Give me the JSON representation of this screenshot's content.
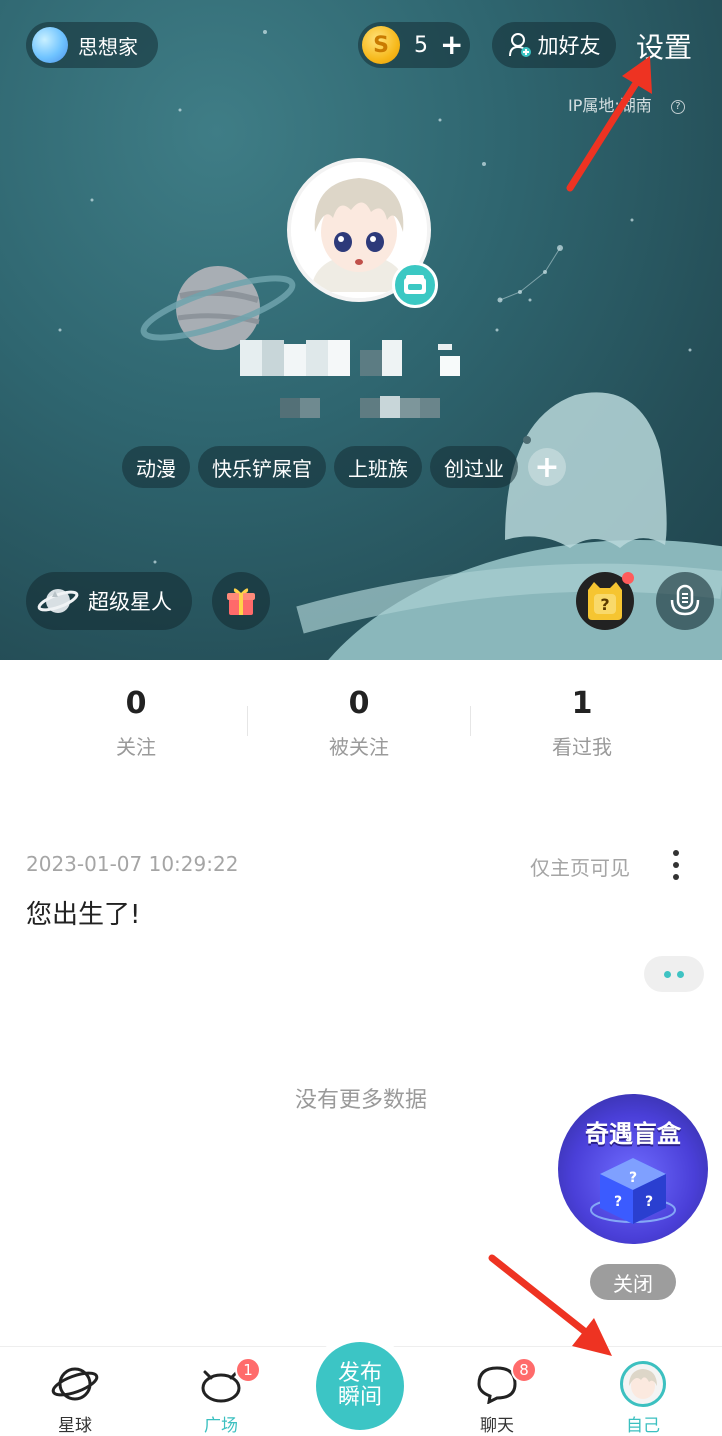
{
  "header": {
    "thinker_label": "思想家",
    "coin_symbol": "S",
    "coin_count": "5",
    "coin_plus": "+",
    "add_friend_label": "加好友",
    "settings_label": "设置",
    "ip_location": "IP属地:湖南",
    "help_symbol": "?"
  },
  "profile": {
    "tags": [
      "动漫",
      "快乐铲屎官",
      "上班族",
      "创过业"
    ],
    "add_tag_symbol": "+",
    "super_star_label": "超级星人"
  },
  "stats": [
    {
      "value": "0",
      "label": "关注"
    },
    {
      "value": "0",
      "label": "被关注"
    },
    {
      "value": "1",
      "label": "看过我"
    }
  ],
  "post": {
    "timestamp": "2023-01-07 10:29:22",
    "visibility": "仅主页可见",
    "content": "您出生了!"
  },
  "feed": {
    "no_more": "没有更多数据"
  },
  "blind_box": {
    "title": "奇遇盲盒",
    "close_label": "关闭"
  },
  "nav": {
    "items": [
      {
        "label": "星球",
        "icon": "planet-icon"
      },
      {
        "label": "广场",
        "icon": "square-icon",
        "badge": "1"
      },
      {
        "label": "聊天",
        "icon": "chat-icon",
        "badge": "8"
      },
      {
        "label": "自己",
        "icon": "avatar"
      }
    ],
    "publish_line1": "发布",
    "publish_line2": "瞬间"
  },
  "colors": {
    "accent": "#3cc5c5",
    "badge_red": "#ff6b6b",
    "annotation_arrow": "#ee3322"
  }
}
